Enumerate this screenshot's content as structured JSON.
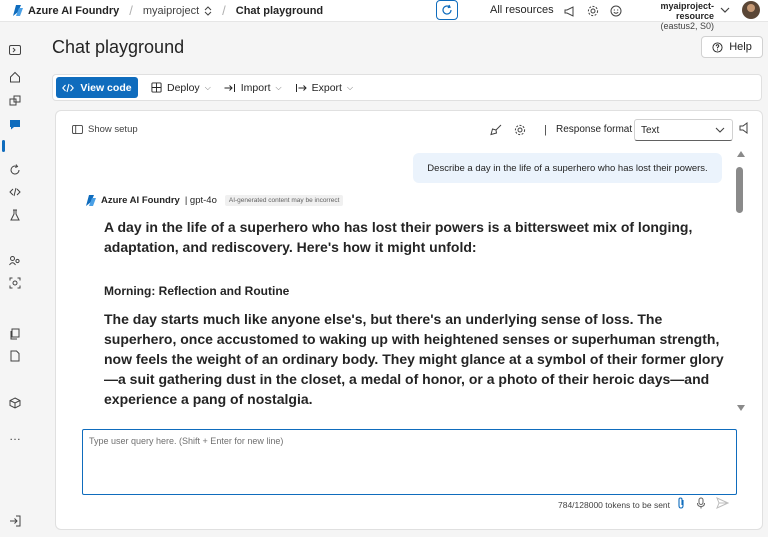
{
  "header": {
    "brand": "Azure AI Foundry",
    "project": "myaiproject",
    "page": "Chat playground",
    "all_resources": "All resources",
    "account_name": "myaiproject-resource",
    "account_region": "(eastus2, S0)"
  },
  "main": {
    "title": "Chat playground",
    "help_label": "Help"
  },
  "toolbar": {
    "view_code": "View code",
    "deploy": "Deploy",
    "import": "Import",
    "export": "Export"
  },
  "panel": {
    "show_setup": "Show setup",
    "response_format_label": "Response format",
    "response_format_value": "Text"
  },
  "chat": {
    "user_message": "Describe a day in the life of a superhero who has lost their powers.",
    "assistant_name": "Azure AI Foundry",
    "model": "| gpt-4o",
    "ai_notice": "AI-generated content may be incorrect",
    "paragraph1": "A day in the life of a superhero who has lost their powers is a bittersweet mix of longing, adaptation, and rediscovery. Here's how it might unfold:",
    "heading": "Morning: Reflection and Routine",
    "paragraph2": "The day starts much like anyone else's, but there's an underlying sense of loss. The superhero, once accustomed to waking up with heightened senses or superhuman strength, now feels the weight of an ordinary body. They might glance at a symbol of their former glory—a suit gathering dust in the closet, a medal of honor, or a photo of their heroic days—and experience a pang of nostalgia."
  },
  "input": {
    "placeholder": "Type user query here. (Shift + Enter for new line)",
    "tokens": "784/128000 tokens to be sent"
  },
  "colors": {
    "accent": "#0f6cbd",
    "user_bubble": "#ebf3fc"
  }
}
